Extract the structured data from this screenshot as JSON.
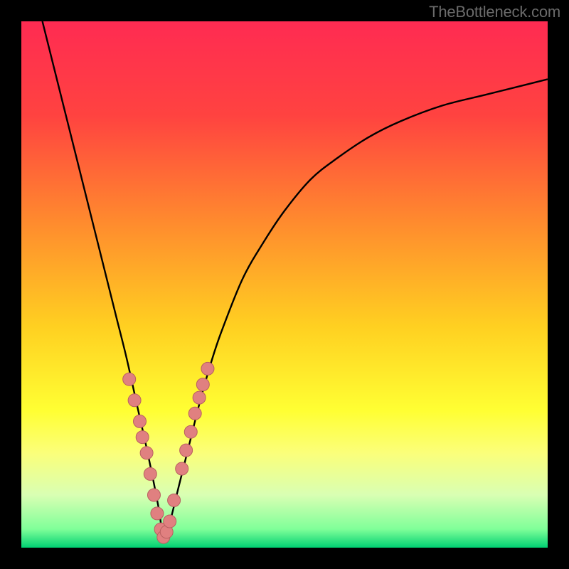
{
  "watermark": "TheBottleneck.com",
  "colors": {
    "frame": "#000000",
    "gradient_stops": [
      {
        "offset": 0.0,
        "color": "#ff2b52"
      },
      {
        "offset": 0.18,
        "color": "#ff4340"
      },
      {
        "offset": 0.38,
        "color": "#ff8a2e"
      },
      {
        "offset": 0.58,
        "color": "#ffd021"
      },
      {
        "offset": 0.74,
        "color": "#ffff33"
      },
      {
        "offset": 0.82,
        "color": "#fbff7a"
      },
      {
        "offset": 0.9,
        "color": "#d9ffb3"
      },
      {
        "offset": 0.965,
        "color": "#7fff99"
      },
      {
        "offset": 1.0,
        "color": "#00d072"
      }
    ],
    "curve": "#000000",
    "marker_fill": "#e08080",
    "marker_stroke": "#b86060"
  },
  "chart_data": {
    "type": "line",
    "title": "",
    "xlabel": "",
    "ylabel": "",
    "xlim": [
      0,
      100
    ],
    "ylim": [
      0,
      100
    ],
    "x_min_point": 27,
    "series": [
      {
        "name": "bottleneck-curve",
        "x": [
          4,
          6,
          8,
          10,
          12,
          14,
          16,
          18,
          20,
          22,
          24,
          26,
          27,
          28,
          30,
          32,
          34,
          36,
          38,
          42,
          46,
          50,
          55,
          60,
          66,
          72,
          80,
          88,
          96,
          100
        ],
        "values": [
          100,
          92,
          84,
          76,
          68,
          60,
          52,
          44,
          36,
          27,
          18,
          8,
          2,
          4,
          12,
          20,
          28,
          35,
          41,
          51,
          58,
          64,
          70,
          74,
          78,
          81,
          84,
          86,
          88,
          89
        ]
      }
    ],
    "markers": {
      "name": "highlight-points",
      "x": [
        20.5,
        21.5,
        22.5,
        23.0,
        23.8,
        24.5,
        25.2,
        25.8,
        26.5,
        27.0,
        27.6,
        28.2,
        29.0,
        30.5,
        31.3,
        32.2,
        33.0,
        33.8,
        34.5,
        35.4
      ],
      "values": [
        32.0,
        28.0,
        24.0,
        21.0,
        18.0,
        14.0,
        10.0,
        6.5,
        3.5,
        2.0,
        3.0,
        5.0,
        9.0,
        15.0,
        18.5,
        22.0,
        25.5,
        28.5,
        31.0,
        34.0
      ]
    }
  }
}
